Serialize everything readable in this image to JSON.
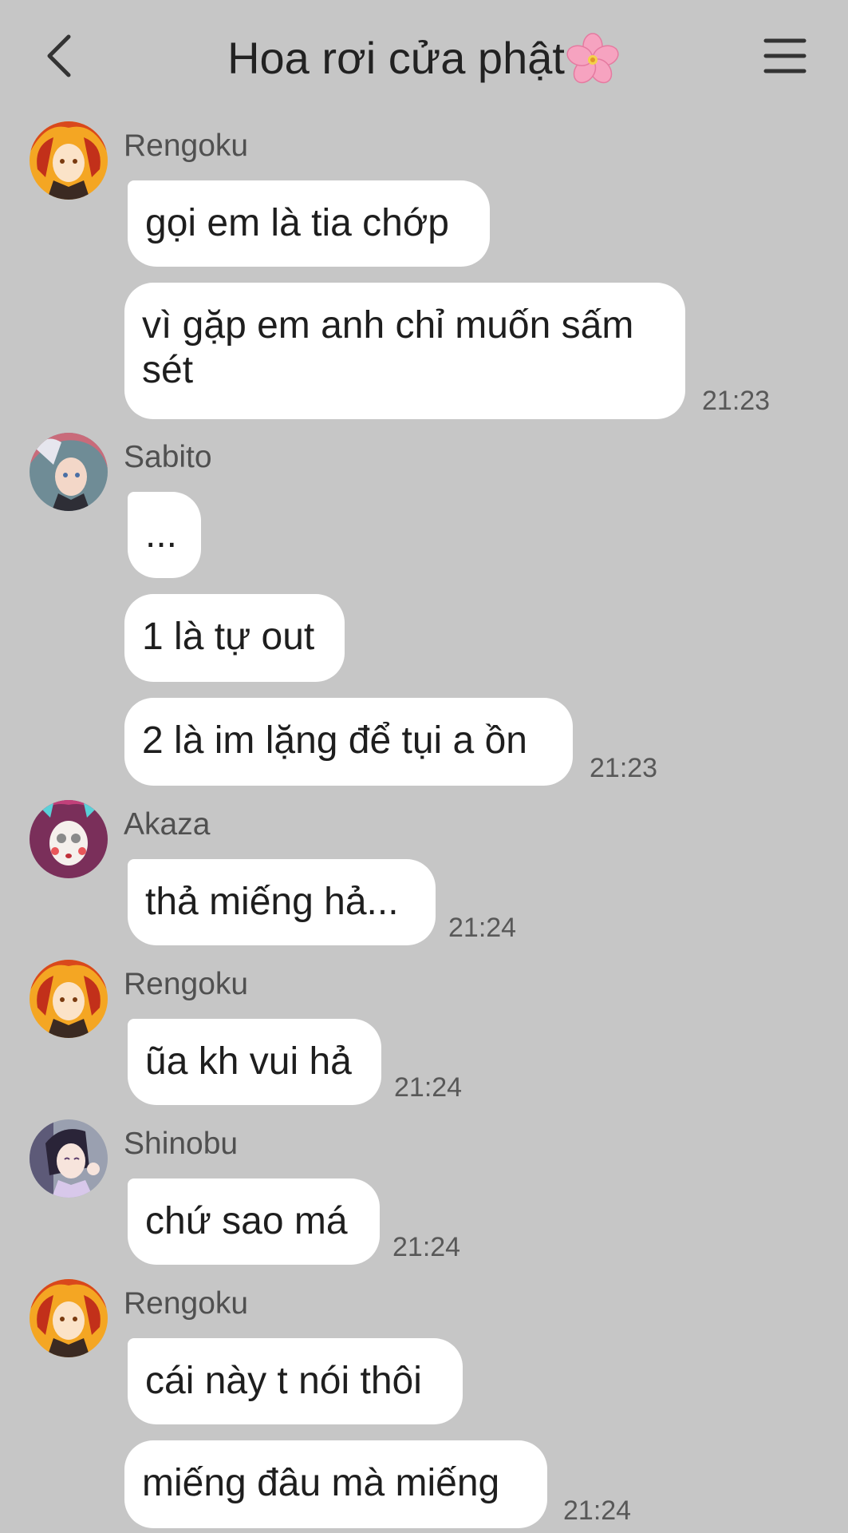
{
  "header": {
    "title": "Hoa rơi cửa phật"
  },
  "messages": {
    "m1": {
      "sender": "Rengoku",
      "b1": "gọi em là tia chớp",
      "b2": "vì gặp em anh chỉ muốn sấm sét",
      "time": "21:23"
    },
    "m2": {
      "sender": "Sabito",
      "b1": "...",
      "b2": "1 là tự out",
      "b3": "2 là im lặng để tụi a ồn",
      "time": "21:23"
    },
    "m3": {
      "sender": "Akaza",
      "b1": "thả miếng hả...",
      "time": "21:24"
    },
    "m4": {
      "sender": "Rengoku",
      "b1": "ũa kh vui hả",
      "time": "21:24"
    },
    "m5": {
      "sender": "Shinobu",
      "b1": "chứ sao má",
      "time": "21:24"
    },
    "m6": {
      "sender": "Rengoku",
      "b1": "cái này t nói thôi",
      "b2": "miếng đâu mà miếng",
      "time": "21:24"
    }
  },
  "colors": {
    "background": "#c6c6c6",
    "bubble": "#ffffff",
    "text": "#1e1e1e",
    "muted": "#585858"
  },
  "icons": [
    "back-arrow-icon",
    "cherry-blossom-icon",
    "menu-icon"
  ]
}
